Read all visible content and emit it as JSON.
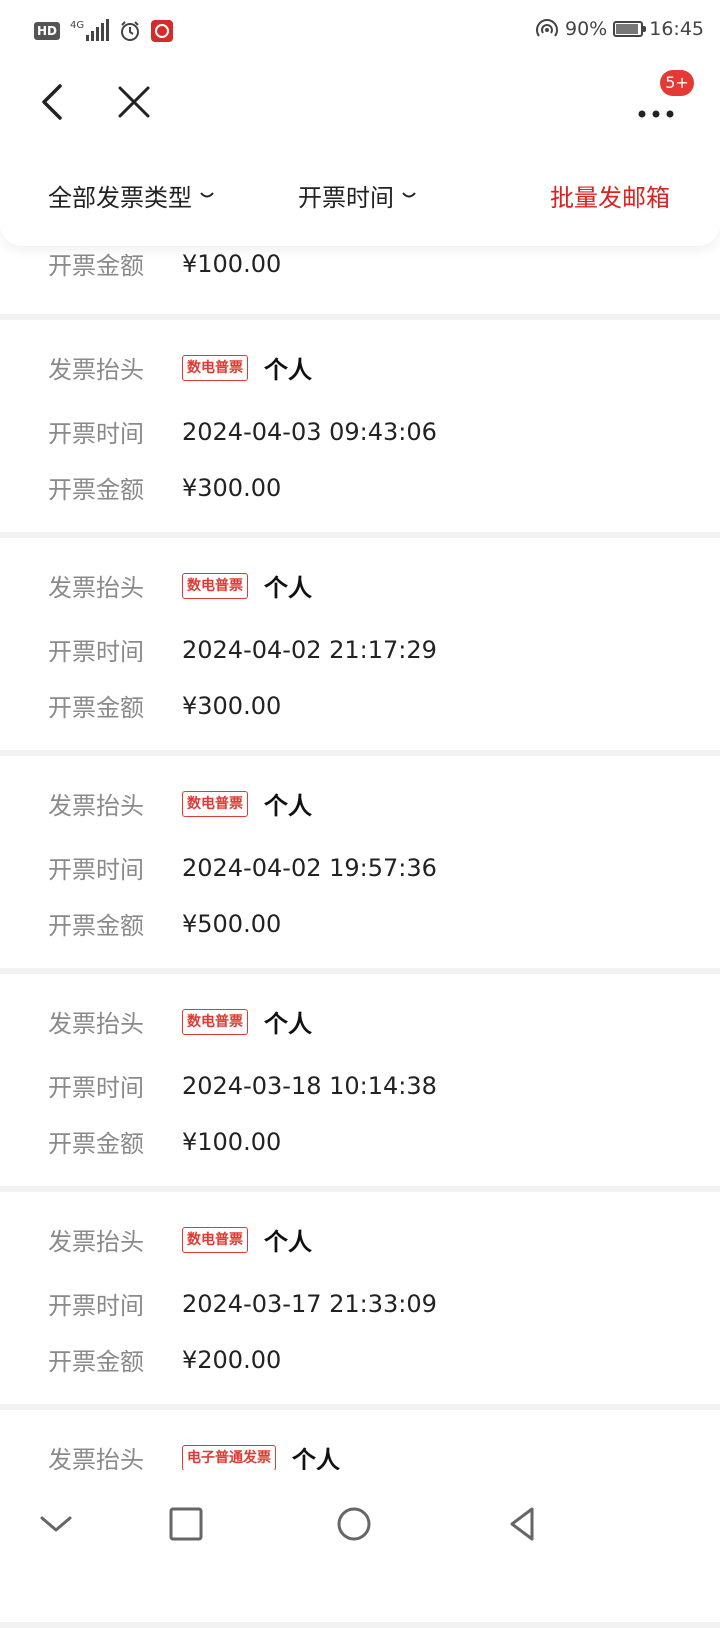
{
  "status_bar": {
    "hd": "HD",
    "network": "4G",
    "battery_percent": "90%",
    "battery_level": 0.9,
    "time": "16:45"
  },
  "nav": {
    "back_icon": "chevron-left-icon",
    "close_icon": "close-icon",
    "more_icon": "more-dots-icon",
    "more_badge": "5+"
  },
  "filters": {
    "type_label": "全部发票类型",
    "time_label": "开票时间",
    "batch_email": "批量发邮箱"
  },
  "labels": {
    "holder": "发票抬头",
    "time": "开票时间",
    "amount": "开票金额"
  },
  "partial_top": {
    "amount": "¥100.00"
  },
  "invoices": [
    {
      "tag": "数电普票",
      "holder": "个人",
      "time": "2024-04-03 09:43:06",
      "amount": "¥300.00"
    },
    {
      "tag": "数电普票",
      "holder": "个人",
      "time": "2024-04-02 21:17:29",
      "amount": "¥300.00"
    },
    {
      "tag": "数电普票",
      "holder": "个人",
      "time": "2024-04-02 19:57:36",
      "amount": "¥500.00"
    },
    {
      "tag": "数电普票",
      "holder": "个人",
      "time": "2024-03-18 10:14:38",
      "amount": "¥100.00"
    },
    {
      "tag": "数电普票",
      "holder": "个人",
      "time": "2024-03-17 21:33:09",
      "amount": "¥200.00"
    },
    {
      "tag": "电子普通发票",
      "holder": "个人"
    }
  ],
  "colors": {
    "accent": "#d8231f",
    "label_gray": "#8a8a8a",
    "divider": "#f2f2f2"
  }
}
